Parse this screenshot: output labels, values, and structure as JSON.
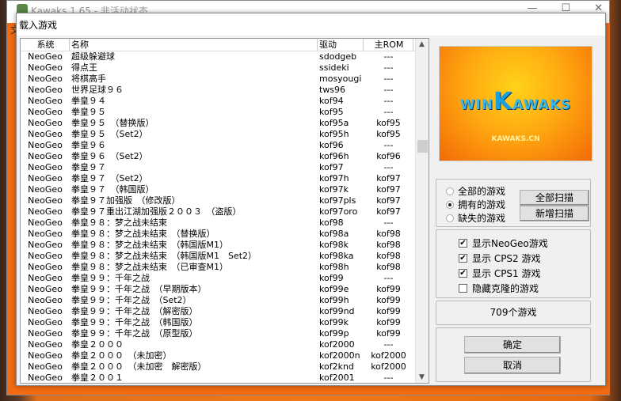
{
  "background_window": {
    "title": "Kawaks 1.65 - 非活动状态",
    "menu_hint": "文"
  },
  "dialog": {
    "title": "载入游戏"
  },
  "list": {
    "columns": [
      "系统",
      "名称",
      "驱动",
      "主ROM"
    ],
    "rows": [
      [
        "NeoGeo",
        "超级躲避球",
        "sdodgeb",
        "---"
      ],
      [
        "NeoGeo",
        "得点王",
        "ssideki",
        "---"
      ],
      [
        "NeoGeo",
        "将棋高手",
        "mosyougi",
        "---"
      ],
      [
        "NeoGeo",
        "世界足球９６",
        "tws96",
        "---"
      ],
      [
        "NeoGeo",
        "拳皇９４",
        "kof94",
        "---"
      ],
      [
        "NeoGeo",
        "拳皇９５",
        "kof95",
        "---"
      ],
      [
        "NeoGeo",
        "拳皇９５　（替换版）",
        "kof95a",
        "kof95"
      ],
      [
        "NeoGeo",
        "拳皇９５　（Set2）",
        "kof95h",
        "kof95"
      ],
      [
        "NeoGeo",
        "拳皇９６",
        "kof96",
        "---"
      ],
      [
        "NeoGeo",
        "拳皇９６　（Set2）",
        "kof96h",
        "kof96"
      ],
      [
        "NeoGeo",
        "拳皇９７",
        "kof97",
        "---"
      ],
      [
        "NeoGeo",
        "拳皇９７　（Set2）",
        "kof97h",
        "kof97"
      ],
      [
        "NeoGeo",
        "拳皇９７　（韩国版）",
        "kof97k",
        "kof97"
      ],
      [
        "NeoGeo",
        "拳皇９７加强版　（修改版）",
        "kof97pls",
        "kof97"
      ],
      [
        "NeoGeo",
        "拳皇９７重出江湖加强版２００３　（盗版）",
        "kof97oro",
        "kof97"
      ],
      [
        "NeoGeo",
        "拳皇９８：梦之战未结束",
        "kof98",
        "---"
      ],
      [
        "NeoGeo",
        "拳皇９８：梦之战未结束　（替换版）",
        "kof98a",
        "kof98"
      ],
      [
        "NeoGeo",
        "拳皇９８：梦之战未结束　（韩国版M1）",
        "kof98k",
        "kof98"
      ],
      [
        "NeoGeo",
        "拳皇９８：梦之战未结束　（韩国版M1　Set2）",
        "kof98ka",
        "kof98"
      ],
      [
        "NeoGeo",
        "拳皇９８：梦之战未结束　（已审查M1）",
        "kof98h",
        "kof98"
      ],
      [
        "NeoGeo",
        "拳皇９９：千年之战",
        "kof99",
        "---"
      ],
      [
        "NeoGeo",
        "拳皇９９：千年之战　（早期版本）",
        "kof99e",
        "kof99"
      ],
      [
        "NeoGeo",
        "拳皇９９：千年之战　（Set2）",
        "kof99h",
        "kof99"
      ],
      [
        "NeoGeo",
        "拳皇９９：千年之战　（解密版）",
        "kof99nd",
        "kof99"
      ],
      [
        "NeoGeo",
        "拳皇９９：千年之战　（韩国版）",
        "kof99k",
        "kof99"
      ],
      [
        "NeoGeo",
        "拳皇９９：千年之战　（原型版）",
        "kof99p",
        "kof99"
      ],
      [
        "NeoGeo",
        "拳皇２０００",
        "kof2000",
        "---"
      ],
      [
        "NeoGeo",
        "拳皇２０００　（未加密）",
        "kof2000n",
        "kof2000"
      ],
      [
        "NeoGeo",
        "拳皇２０００　（未加密　解密版）",
        "kof2knd",
        "kof2000"
      ],
      [
        "NeoGeo",
        "拳皇２００１",
        "kof2001",
        "---"
      ]
    ]
  },
  "logo": {
    "text": "WIN KAWAKS",
    "sub": "KAWAKS.CN"
  },
  "filter": {
    "options": [
      {
        "label": "全部的游戏",
        "selected": false
      },
      {
        "label": "拥有的游戏",
        "selected": true
      },
      {
        "label": "缺失的游戏",
        "selected": false
      }
    ],
    "scan_all": "全部扫描",
    "scan_new": "新增扫描"
  },
  "display": {
    "options": [
      {
        "label": "显示NeoGeo游戏",
        "checked": true
      },
      {
        "label": "显示 CPS2 游戏",
        "checked": true
      },
      {
        "label": "显示 CPS1 游戏",
        "checked": true
      },
      {
        "label": "隐藏克隆的游戏",
        "checked": false
      }
    ]
  },
  "status": "709个游戏",
  "buttons": {
    "ok": "确定",
    "cancel": "取消"
  }
}
